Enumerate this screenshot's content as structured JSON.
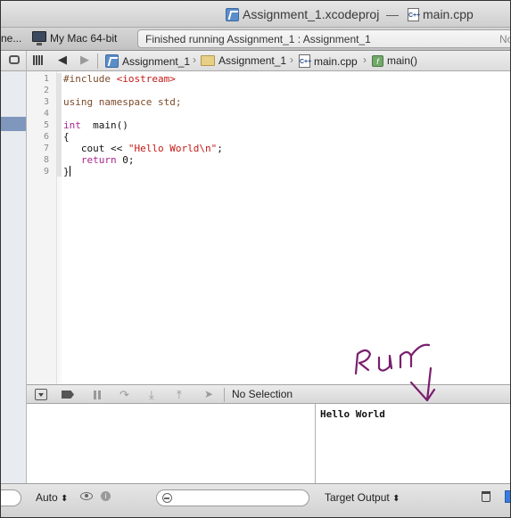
{
  "window": {
    "project_title": "Assignment_1.xcodeproj",
    "title_separator": "—",
    "file_title": "main.cpp"
  },
  "toolbar": {
    "scheme_truncated": "ne...",
    "destination": "My Mac 64-bit",
    "activity_text": "Finished running Assignment_1 : Assignment_1",
    "activity_extra": "No"
  },
  "jumpbar": {
    "back_glyph": "◀",
    "forward_glyph": "▶",
    "crumbs": [
      {
        "label": "Assignment_1",
        "icon": "xcode-project-icon"
      },
      {
        "label": "Assignment_1",
        "icon": "folder-icon"
      },
      {
        "label": "main.cpp",
        "icon": "cpp-file-icon"
      },
      {
        "label": "main()",
        "icon": "function-icon"
      }
    ],
    "separator": "›",
    "function_glyph": "f"
  },
  "editor": {
    "lines": [
      {
        "n": "1",
        "parts": [
          {
            "t": "#include ",
            "c": "pp"
          },
          {
            "t": "<iostream>",
            "c": "str"
          }
        ]
      },
      {
        "n": "2",
        "parts": []
      },
      {
        "n": "3",
        "parts": [
          {
            "t": "using namespace std;",
            "c": "pp"
          }
        ]
      },
      {
        "n": "4",
        "parts": []
      },
      {
        "n": "5",
        "parts": [
          {
            "t": "int",
            "c": "kw"
          },
          {
            "t": "  main()",
            "c": ""
          }
        ]
      },
      {
        "n": "6",
        "parts": [
          {
            "t": "{",
            "c": ""
          }
        ]
      },
      {
        "n": "7",
        "parts": [
          {
            "t": "   cout << ",
            "c": ""
          },
          {
            "t": "\"Hello World\\n\"",
            "c": "str"
          },
          {
            "t": ";",
            "c": ""
          }
        ]
      },
      {
        "n": "8",
        "parts": [
          {
            "t": "   ",
            "c": ""
          },
          {
            "t": "return",
            "c": "kw"
          },
          {
            "t": " 0;",
            "c": ""
          }
        ]
      },
      {
        "n": "9",
        "parts": [
          {
            "t": "}",
            "c": ""
          }
        ]
      }
    ]
  },
  "debug_bar": {
    "step_over_glyph": "↷",
    "step_into_glyph": "⤓",
    "step_out_glyph": "⤒",
    "location_glyph": "➤",
    "no_selection": "No Selection"
  },
  "console": {
    "output_text": "Hello World"
  },
  "bottom_bar": {
    "auto_label": "Auto",
    "target_output_label": "Target Output",
    "updown_glyph": "⬍",
    "info_glyph": "i"
  },
  "annotation": {
    "handwritten_text": "Run",
    "color": "#7a1f6e"
  },
  "colors": {
    "keyword": "#a9268f",
    "string": "#c41a16",
    "preprocessor": "#7b4b2a",
    "selection": "#7f97bd"
  }
}
